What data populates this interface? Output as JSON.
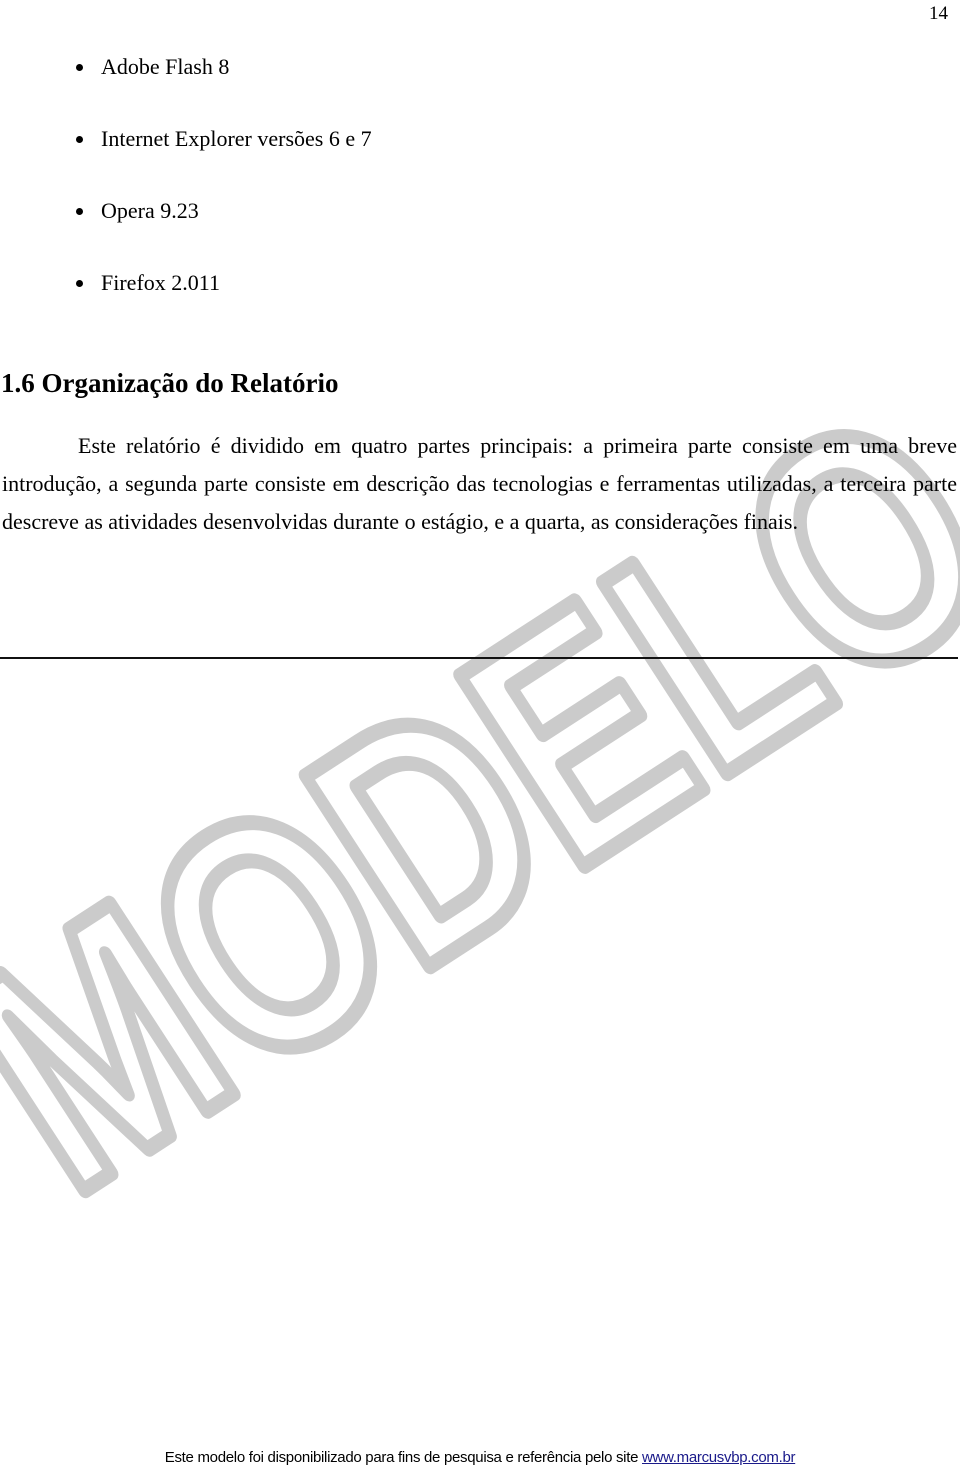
{
  "page": {
    "number": "14",
    "watermark": "MODELO"
  },
  "bullets": [
    {
      "text": "Adobe Flash 8"
    },
    {
      "text": "Internet Explorer versões 6 e 7"
    },
    {
      "text": "Opera 9.23"
    },
    {
      "text": "Firefox 2.011"
    }
  ],
  "section": {
    "heading": "1.6 Organização do Relatório",
    "paragraph": "Este relatório é dividido em quatro partes principais: a primeira parte consiste em uma breve introdução, a segunda parte consiste em descrição das tecnologias e ferramentas utilizadas, a terceira parte descreve as atividades desenvolvidas durante o estágio, e a quarta, as considerações finais."
  },
  "footer": {
    "text": "Este modelo foi disponibilizado para fins de pesquisa e referência pelo site ",
    "link_text": "www.marcusvbp.com.br"
  },
  "colors": {
    "text": "#000000",
    "watermark": "#cbcbcb",
    "link": "#1a1a8a"
  }
}
